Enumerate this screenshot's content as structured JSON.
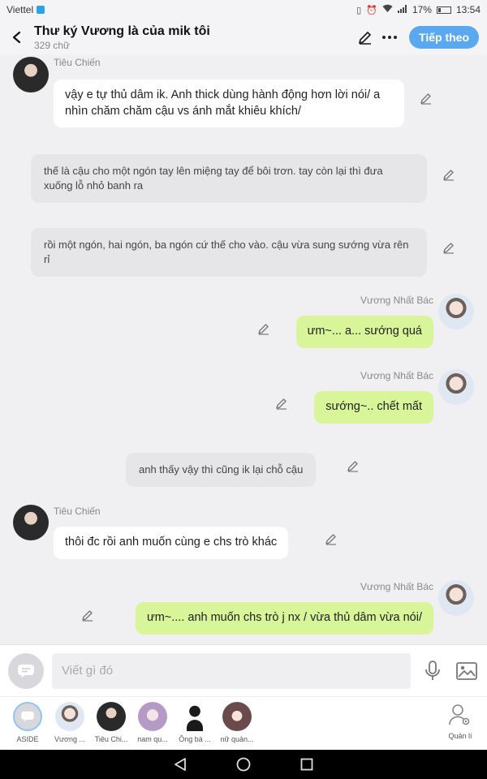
{
  "status": {
    "carrier": "Viettel",
    "battery": "17%",
    "battery_level": 0.17,
    "time": "13:54"
  },
  "header": {
    "title": "Thư ký Vương là của mik tôi",
    "subtitle": "329 chữ",
    "follow_label": "Tiếp theo"
  },
  "messages": [
    {
      "kind": "left",
      "sender": "Tiêu Chiến",
      "text": "vậy e tự thủ dâm ik. Anh thick dùng hành động hơn lời nói/ a nhìn chăm chăm cậu vs ánh mắt khiêu khích/"
    },
    {
      "kind": "narration",
      "text": "thế là cậu cho một ngón tay lên miệng tay để bôi trơn. tay còn lại thì đưa xuống lỗ nhỏ banh ra"
    },
    {
      "kind": "narration",
      "text": "rồi một ngón, hai ngón, ba ngón cứ thế cho vào. cậu vừa sung sướng vừa rên rỉ"
    },
    {
      "kind": "right",
      "sender": "Vương Nhất Bác",
      "text": "ưm~... a... sướng quá"
    },
    {
      "kind": "right",
      "sender": "Vương Nhất Bác",
      "text": "sướng~.. chết mất"
    },
    {
      "kind": "narration",
      "text": "anh thấy vậy thì cũng ik lại chỗ cậu"
    },
    {
      "kind": "left",
      "sender": "Tiêu Chiến",
      "text": "thôi đc rồi anh muốn cùng e chs trò khác"
    },
    {
      "kind": "right",
      "sender": "Vương Nhất Bác",
      "text": "ưm~.... anh muốn chs trò j nx / vừa thủ dâm vừa nói/"
    }
  ],
  "input": {
    "placeholder": "Viết gì đó"
  },
  "characters": [
    {
      "label": "ASIDE"
    },
    {
      "label": "Vương ..."
    },
    {
      "label": "Tiêu Chi..."
    },
    {
      "label": "nam qu..."
    },
    {
      "label": "Ông bà ..."
    },
    {
      "label": "nữ quản..."
    }
  ],
  "manage_label": "Quản lí",
  "colors": {
    "accent": "#5aa9f0",
    "green_bubble": "#d8f59a",
    "narration_bubble": "#e6e6e8",
    "background": "#f0f0f2"
  }
}
